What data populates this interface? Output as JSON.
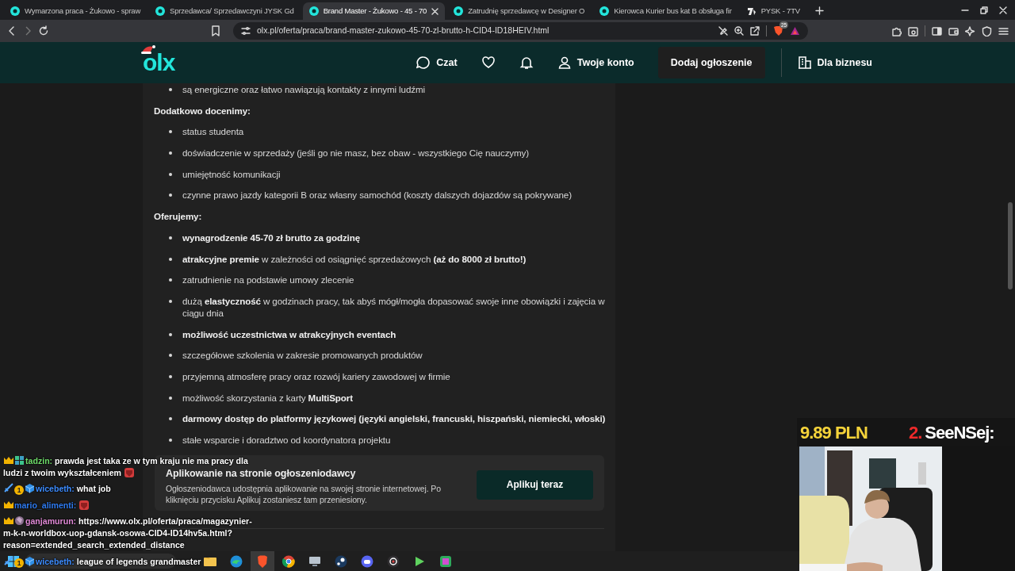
{
  "browser": {
    "tabs": [
      {
        "title": "Wymarzona praca - Żukowo - spraw",
        "kind": "circle",
        "selected": false
      },
      {
        "title": "Sprzedawca/ Sprzedawczyni JYSK Gd",
        "kind": "circle",
        "selected": false
      },
      {
        "title": "Brand Master - Żukowo - 45 - 70",
        "kind": "circle",
        "selected": true
      },
      {
        "title": "Zatrudnię sprzedawcę w Designer O",
        "kind": "circle",
        "selected": false
      },
      {
        "title": "Kierowca Kurier bus kat B obsługa fir",
        "kind": "circle",
        "selected": false
      },
      {
        "title": "PYSK - 7TV",
        "kind": "angular",
        "selected": false
      }
    ],
    "address": "olx.pl/oferta/praca/brand-master-zukowo-45-70-zl-brutto-h-CID4-ID18HEIV.html",
    "shields_count": "25"
  },
  "header": {
    "logo": "olx",
    "nav": [
      {
        "kind": "chat",
        "label": "Czat"
      },
      {
        "kind": "heart"
      },
      {
        "kind": "bell"
      },
      {
        "kind": "account",
        "label": "Twoje konto"
      }
    ],
    "post_button": "Dodaj ogłoszenie",
    "business_link": "Dla biznesu"
  },
  "content": {
    "sections": [
      {
        "items": [
          "są energiczne oraz łatwo nawiązują kontakty z innymi ludźmi"
        ]
      },
      {
        "heading": "Dodatkowo docenimy:",
        "items": [
          "status studenta",
          "doświadczenie w sprzedaży (jeśli go nie masz, bez obaw - wszystkiego Cię nauczymy)",
          "umiejętność komunikacji",
          "czynne prawo jazdy kategorii B oraz własny samochód (koszty dalszych dojazdów są pokrywane)"
        ]
      },
      {
        "heading": "Oferujemy:",
        "items": [
          "**wynagrodzenie 45-70 zł brutto za godzinę**",
          "**atrakcyjne premie** w zależności od osiągnięć sprzedażowych **(aż do 8000 zł brutto!)**",
          "zatrudnienie na podstawie umowy zlecenie",
          "dużą **elastyczność** w godzinach pracy, tak abyś mógł/mogła dopasować swoje inne obowiązki i zajęcia w ciągu dnia",
          "**możliwość uczestnictwa w atrakcyjnych eventach**",
          "szczegółowe szkolenia w zakresie promowanych produktów",
          "przyjemną atmosferę pracy oraz rozwój kariery zawodowej w firmie",
          "możliwość skorzystania z karty **MultiSport**",
          "**darmowy dostęp do platformy językowej (języki angielski, francuski, hiszpański, niemiecki, włoski)**",
          "stałe wsparcie i doradztwo od koordynatora projektu"
        ]
      }
    ],
    "apply": {
      "title": "Aplikowanie na stronie ogłoszeniodawcy",
      "text": "Ogłoszeniodawca udostępnia aplikowanie na swojej stronie internetowej. Po kliknięciu przycisku Aplikuj zostaniesz tam przeniesiony.",
      "button": "Aplikuj teraz"
    }
  },
  "chat": [
    {
      "badges": [
        {
          "kind": "crown"
        },
        {
          "kind": "grid"
        }
      ],
      "user": "tadzin:",
      "color": "#6fdc6a",
      "lines": [
        "prawda jest taka ze w tym kraju nie ma pracy dla",
        "ludzi z twoim wykształceniem"
      ],
      "emote": true
    },
    {
      "badges": [
        {
          "kind": "sword"
        },
        {
          "kind": "months",
          "label": "1"
        },
        {
          "kind": "cube"
        }
      ],
      "user": "wicebeth:",
      "color": "#3d8cff",
      "lines": [
        "what job"
      ],
      "emote": false
    },
    {
      "badges": [
        {
          "kind": "crown"
        }
      ],
      "user": "mario_alimenti:",
      "color": "#2f7bf0",
      "emote": true
    },
    {
      "badges": [
        {
          "kind": "crown"
        },
        {
          "kind": "dragon"
        }
      ],
      "user": "ganjamurun:",
      "color": "#e08ad6",
      "lines": [
        "https://www.olx.pl/oferta/praca/magazynier-",
        "m-k-n-worldbox-uop-gdansk-osowa-CID4-ID14hv5a.html?",
        "reason=extended_search_extended_distance"
      ],
      "emote": false
    },
    {
      "badges": [
        {
          "kind": "sword"
        },
        {
          "kind": "months",
          "label": "1"
        },
        {
          "kind": "cube"
        }
      ],
      "user": "wicebeth:",
      "color": "#3d8cff",
      "lines": [
        "league of legends grandmaster"
      ],
      "emote": false
    }
  ],
  "ticker": {
    "amount": "9.89 PLN",
    "rank": "2.",
    "name": "SeeNSej:"
  },
  "taskbar": {
    "apps": [
      {
        "kind": "folder",
        "selected": false
      },
      {
        "kind": "edge",
        "selected": false
      },
      {
        "kind": "lion",
        "selected": true
      },
      {
        "kind": "chrome",
        "selected": false
      },
      {
        "kind": "monitor",
        "selected": false
      },
      {
        "kind": "steam",
        "selected": false
      },
      {
        "kind": "discord",
        "selected": false
      },
      {
        "kind": "record",
        "selected": false
      },
      {
        "kind": "game",
        "selected": false
      },
      {
        "kind": "chatapp",
        "selected": false
      }
    ]
  }
}
